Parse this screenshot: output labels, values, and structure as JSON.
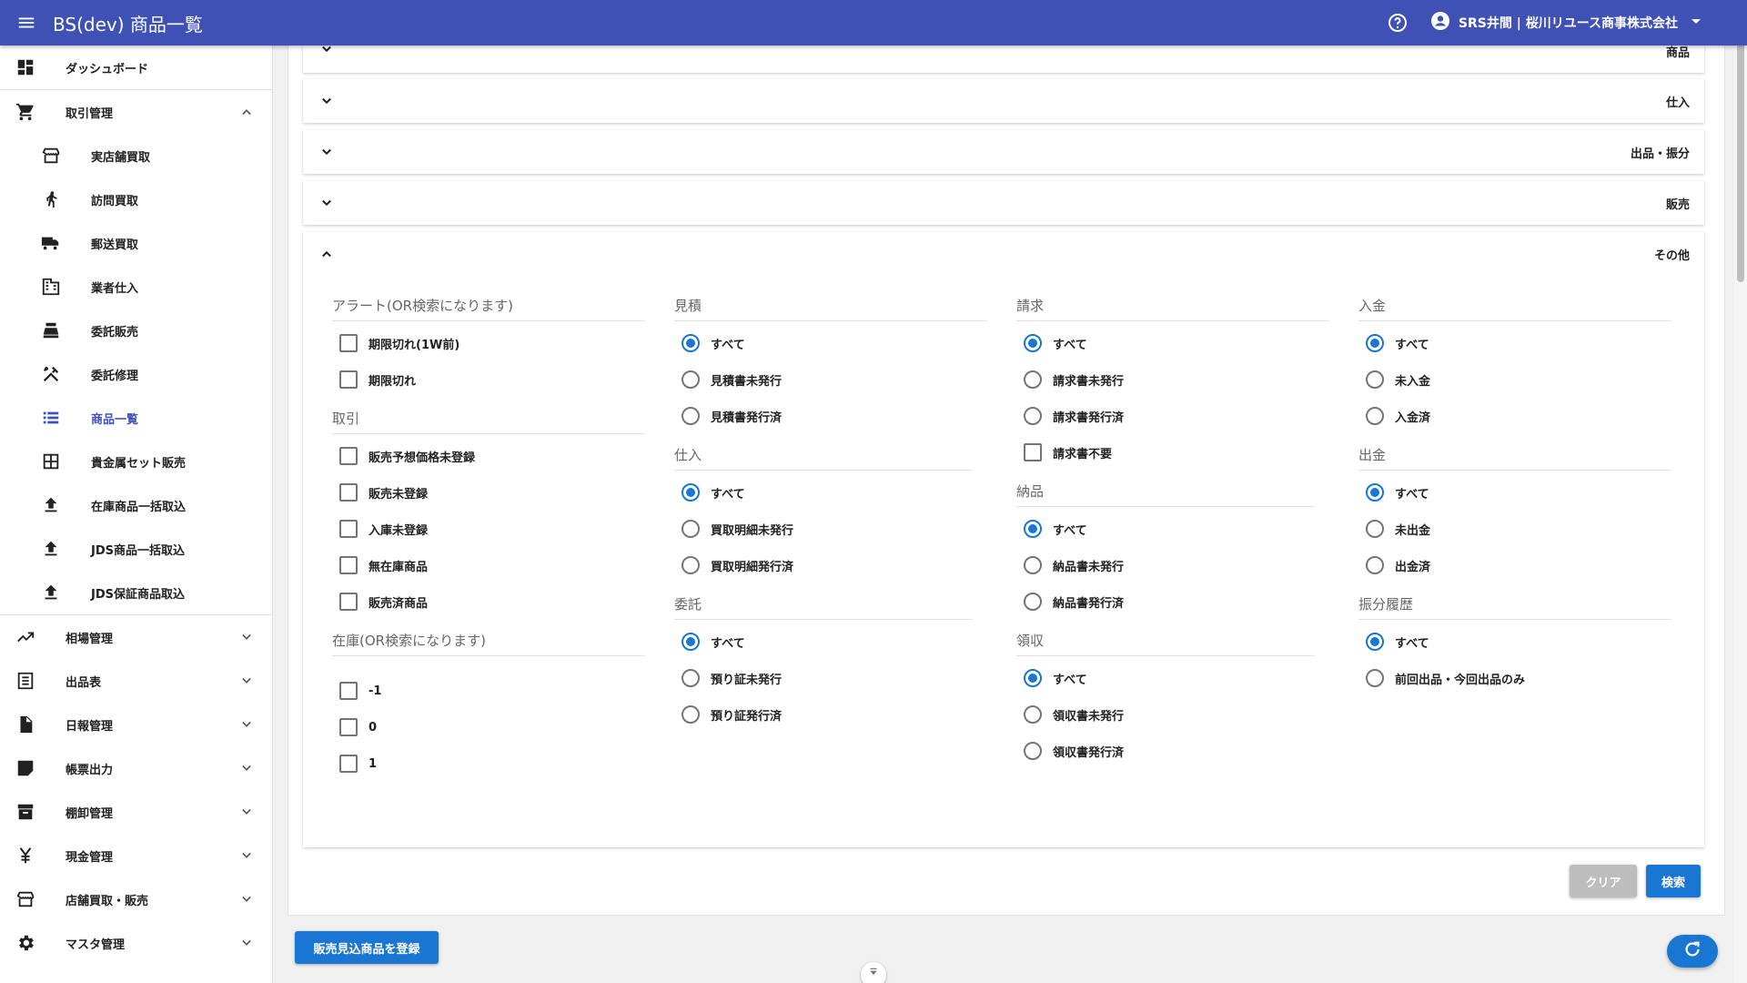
{
  "header": {
    "title": "BS(dev) 商品一覧",
    "user": "SRS井間 | 桜川リユース商事株式会社"
  },
  "sidebar": {
    "items": [
      {
        "label": "ダッシュボード"
      },
      {
        "label": "取引管理"
      },
      {
        "label": "実店舗買取"
      },
      {
        "label": "訪問買取"
      },
      {
        "label": "郵送買取"
      },
      {
        "label": "業者仕入"
      },
      {
        "label": "委託販売"
      },
      {
        "label": "委託修理"
      },
      {
        "label": "商品一覧"
      },
      {
        "label": "貴金属セット販売"
      },
      {
        "label": "在庫商品一括取込"
      },
      {
        "label": "JDS商品一括取込"
      },
      {
        "label": "JDS保証商品取込"
      },
      {
        "label": "相場管理"
      },
      {
        "label": "出品表"
      },
      {
        "label": "日報管理"
      },
      {
        "label": "帳票出力"
      },
      {
        "label": "棚卸管理"
      },
      {
        "label": "現金管理"
      },
      {
        "label": "店舗買取・販売"
      },
      {
        "label": "マスタ管理"
      }
    ]
  },
  "panels": {
    "shohin": "商品",
    "shiire": "仕入",
    "shuppin": "出品・振分",
    "hanbai": "販売",
    "sonota": "その他"
  },
  "filters": {
    "alert": {
      "title": "アラート(OR検索になります)",
      "options": [
        "期限切れ(1W前)",
        "期限切れ"
      ]
    },
    "torihiki": {
      "title": "取引",
      "options": [
        "販売予想価格未登録",
        "販売未登録",
        "入庫未登録",
        "無在庫商品",
        "販売済商品"
      ]
    },
    "zaiko": {
      "title": "在庫(OR検索になります)",
      "options": [
        "-1",
        "0",
        "1"
      ]
    },
    "mitsumori": {
      "title": "見積",
      "options": [
        "すべて",
        "見積書未発行",
        "見積書発行済"
      ]
    },
    "shiire": {
      "title": "仕入",
      "options": [
        "すべて",
        "買取明細未発行",
        "買取明細発行済"
      ]
    },
    "itaku": {
      "title": "委託",
      "options": [
        "すべて",
        "預り証未発行",
        "預り証発行済"
      ]
    },
    "seikyu": {
      "title": "請求",
      "options": [
        "すべて",
        "請求書未発行",
        "請求書発行済"
      ],
      "extra": "請求書不要"
    },
    "nohin": {
      "title": "納品",
      "options": [
        "すべて",
        "納品書未発行",
        "納品書発行済"
      ]
    },
    "ryoshu": {
      "title": "領収",
      "options": [
        "すべて",
        "領収書未発行",
        "領収書発行済"
      ]
    },
    "nyukin": {
      "title": "入金",
      "options": [
        "すべて",
        "未入金",
        "入金済"
      ]
    },
    "shukkin": {
      "title": "出金",
      "options": [
        "すべて",
        "未出金",
        "出金済"
      ]
    },
    "furiwake": {
      "title": "振分履歴",
      "options": [
        "すべて",
        "前回出品・今回出品のみ"
      ]
    }
  },
  "buttons": {
    "clear": "クリア",
    "search": "検索",
    "register": "販売見込商品を登録"
  },
  "colors": {
    "primary": "#3f51b5",
    "accent": "#1976d2",
    "disabled": "#bdbdbd"
  }
}
